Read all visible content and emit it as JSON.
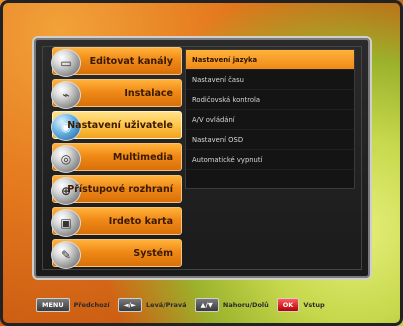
{
  "menu": {
    "items": [
      {
        "label": "Editovat kanály",
        "icon": "tv-icon",
        "selected": false
      },
      {
        "label": "Instalace",
        "icon": "satellite-dish-icon",
        "selected": false
      },
      {
        "label": "Nastavení uživatele",
        "icon": "user-settings-icon",
        "selected": true
      },
      {
        "label": "Multimedia",
        "icon": "multimedia-icon",
        "selected": false
      },
      {
        "label": "Přístupové rozhraní",
        "icon": "access-interface-icon",
        "selected": false
      },
      {
        "label": "Irdeto karta",
        "icon": "smart-card-icon",
        "selected": false
      },
      {
        "label": "Systém",
        "icon": "system-icon",
        "selected": false
      }
    ]
  },
  "submenu": {
    "items": [
      {
        "label": "Nastavení jazyka",
        "selected": true
      },
      {
        "label": "Nastavení času",
        "selected": false
      },
      {
        "label": "Rodičovská kontrola",
        "selected": false
      },
      {
        "label": "A/V ovládání",
        "selected": false
      },
      {
        "label": "Nastavení OSD",
        "selected": false
      },
      {
        "label": "Automatické vypnutí",
        "selected": false
      }
    ]
  },
  "footer": {
    "keys": [
      {
        "key": "MENU",
        "label": "Předchozí",
        "name": "menu-key"
      },
      {
        "key": "◄/►",
        "label": "Levá/Pravá",
        "name": "left-right-key"
      },
      {
        "key": "▲/▼",
        "label": "Nahoru/Dolů",
        "name": "up-down-key"
      },
      {
        "key": "OK",
        "label": "Vstup",
        "name": "ok-key"
      }
    ]
  },
  "colors": {
    "accent": "#f08a17",
    "selected": "#ffc64a"
  }
}
